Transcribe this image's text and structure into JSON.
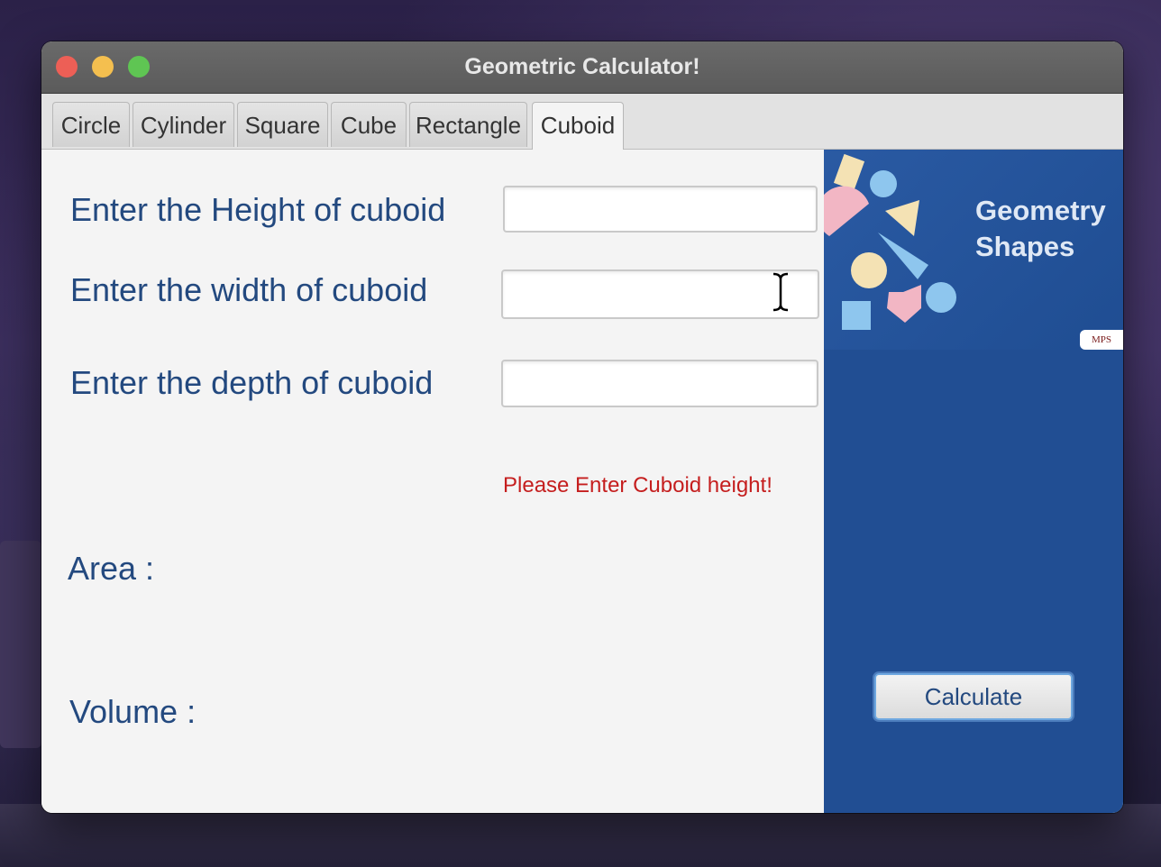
{
  "window": {
    "title": "Geometric Calculator!"
  },
  "tabs": [
    {
      "label": "Circle"
    },
    {
      "label": "Cylinder"
    },
    {
      "label": "Square"
    },
    {
      "label": "Cube"
    },
    {
      "label": "Rectangle"
    },
    {
      "label": "Cuboid",
      "active": true
    }
  ],
  "form": {
    "height_label": "Enter the Height of cuboid",
    "height_value": "",
    "width_label": "Enter the width of cuboid",
    "width_value": "",
    "depth_label": "Enter the depth of cuboid",
    "depth_value": "",
    "error_message": "Please Enter Cuboid height!"
  },
  "results": {
    "area_label": "Area :",
    "volume_label": "Volume :"
  },
  "sidebar": {
    "banner_title_line1": "Geometry",
    "banner_title_line2": "Shapes",
    "logo_text": "MPS",
    "calculate_label": "Calculate"
  },
  "colors": {
    "label_blue": "#23497f",
    "panel_blue": "#214e93",
    "error_red": "#c51e1e"
  }
}
